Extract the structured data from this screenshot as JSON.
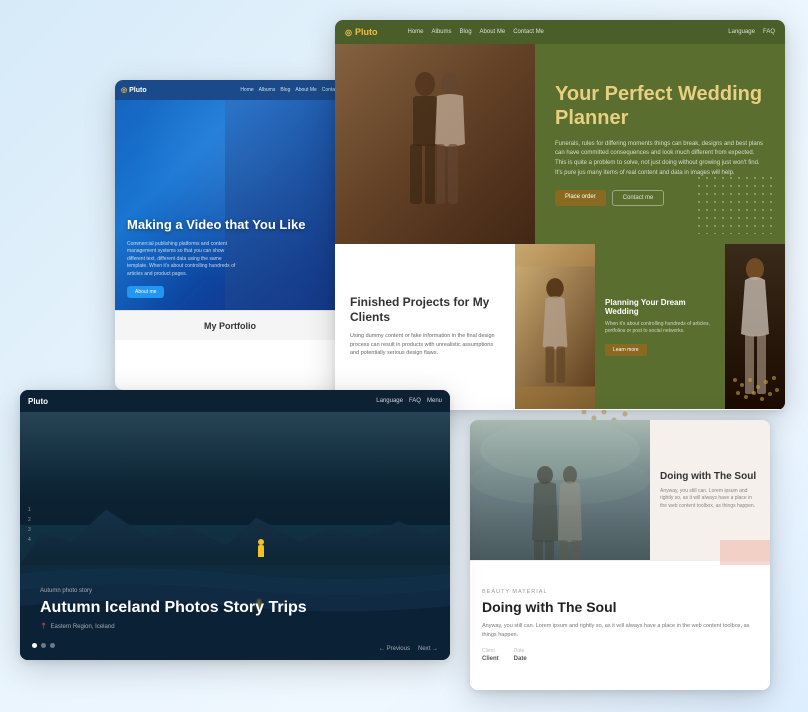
{
  "portfolio": {
    "logo": "Pluto",
    "nav_links": [
      "Home",
      "Albums",
      "Blog",
      "About Me",
      "Contact"
    ],
    "hero_title": "Making a Video that You Like",
    "hero_subtitle": "Commercial publishing platforms and content management systems so that you can show different text, different data using the same template. When it's about controlling hundreds of articles and product pages.",
    "hero_btn": "About me",
    "footer_text": "My Portfolio"
  },
  "wedding": {
    "logo": "Pluto",
    "nav_links": [
      "Home",
      "Albums",
      "Blog",
      "About Me",
      "Contact Me"
    ],
    "nav_right": [
      "Language",
      "FAQ"
    ],
    "hero_title": "Your Perfect Wedding Planner",
    "hero_subtitle": "Funerals, rules for differing moments things can break, designs and best plans can have committed consequences and look much different from expected. This is quite a problem to solve, not just doing without growing just won't find. It's pure jus many items of real content and data in images will help.",
    "btn_primary": "Place order",
    "btn_secondary": "Contact me",
    "section_title": "Finished Projects for My Clients",
    "section_sub": "Using dummy content or fake information in the final design process can result in products with unrealistic assumptions and potentially serious design flaws.",
    "card_title": "Planning Your Dream Wedding",
    "card_sub": "When it's about controlling hundreds of articles, portfolios or post to social networks.",
    "card_btn": "Learn more"
  },
  "iceland": {
    "logo": "Pluto",
    "nav_right": [
      "Language",
      "FAQ",
      "Menu"
    ],
    "tag": "Autumn photo story",
    "title": "Autumn Iceland Photos Story Trips",
    "location": "Eastern Region, Iceland",
    "side_nums": [
      "1",
      "2",
      "3",
      "4"
    ],
    "prev": "← Previous",
    "next": "Next →"
  },
  "soul": {
    "top_title": "Doing with The Soul",
    "top_sub": "Anyway, you still can. Lorem ipsum and rightly so, as it will always have a place in the web content toolbox, as things happen.",
    "bottom_label": "Beauty Material",
    "bottom_title": "Doing with The Soul",
    "bottom_sub": "Anyway, you still can. Lorem ipsum and rightly so, as it will always have a place in the web content toolbox, as things happen.",
    "meta_client_label": "Client",
    "meta_client_value": "Client",
    "meta_date_label": "Date",
    "meta_date_value": "Date"
  }
}
